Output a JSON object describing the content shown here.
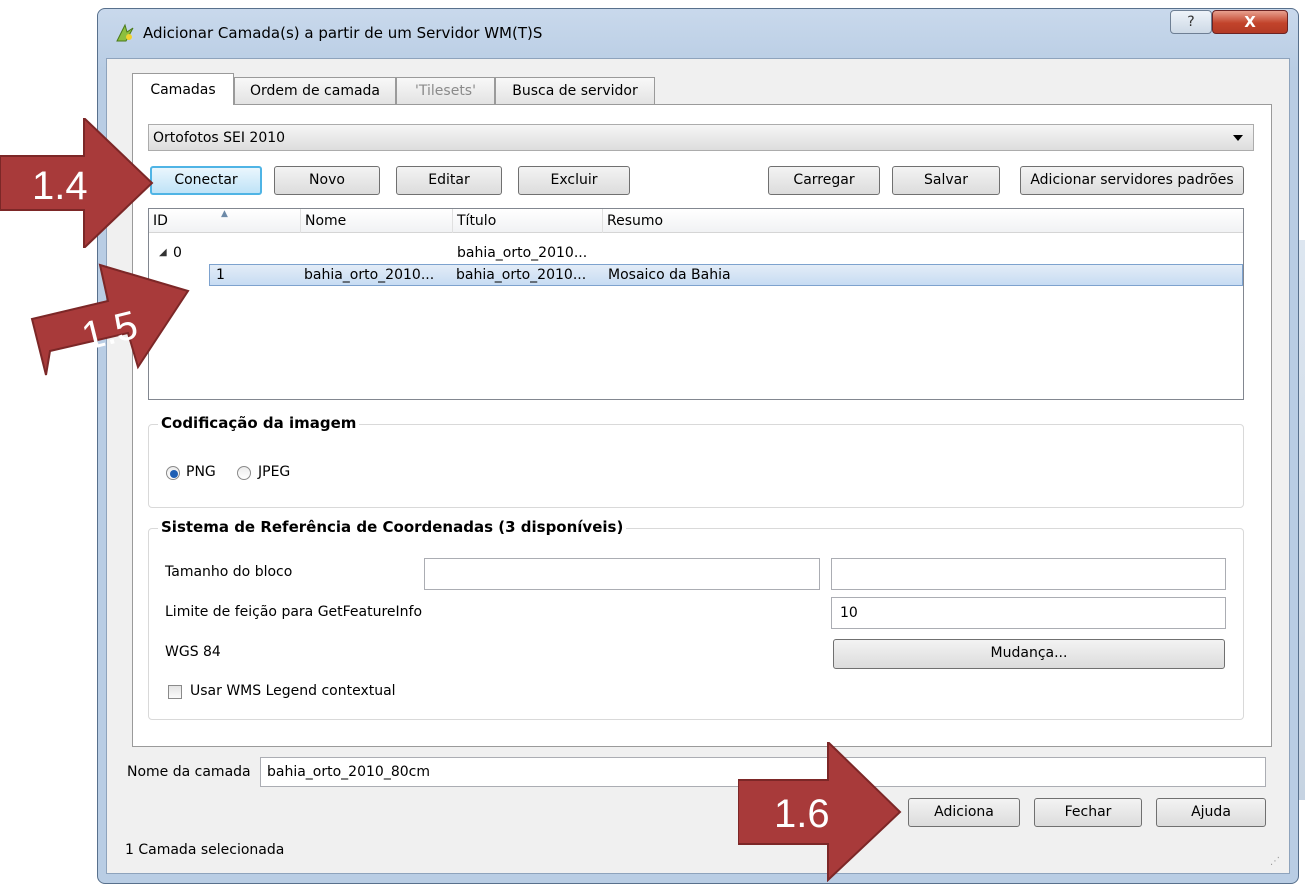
{
  "window": {
    "title": "Adicionar Camada(s) a partir de um Servidor WM(T)S",
    "help_label": "?",
    "close_label": "X"
  },
  "tabs": [
    {
      "label": "Camadas",
      "active": true
    },
    {
      "label": "Ordem de camada",
      "active": false
    },
    {
      "label": "'Tilesets'",
      "active": false,
      "disabled": true
    },
    {
      "label": "Busca de servidor",
      "active": false
    }
  ],
  "server": {
    "selected": "Ortofotos SEI 2010"
  },
  "buttons": {
    "conectar": "Conectar",
    "novo": "Novo",
    "editar": "Editar",
    "excluir": "Excluir",
    "carregar": "Carregar",
    "salvar": "Salvar",
    "adicionar_servidores": "Adicionar servidores padrões"
  },
  "layer_table": {
    "columns": [
      "ID",
      "Nome",
      "Título",
      "Resumo"
    ],
    "rows": [
      {
        "id": "0",
        "nome": "",
        "titulo": "bahia_orto_2010...",
        "resumo": "",
        "expanded": true
      },
      {
        "id": "1",
        "nome": "bahia_orto_2010...",
        "titulo": "bahia_orto_2010...",
        "resumo": "Mosaico da Bahia",
        "selected": true
      }
    ]
  },
  "encoding": {
    "title": "Codificação da imagem",
    "options": [
      "PNG",
      "JPEG"
    ],
    "selected": "PNG"
  },
  "crs": {
    "title": "Sistema de Referência de Coordenadas (3 disponíveis)",
    "tile_size_label": "Tamanho do bloco",
    "tile_size_a": "",
    "tile_size_b": "",
    "feature_limit_label": "Limite de feição para GetFeatureInfo",
    "feature_limit_value": "10",
    "crs_name": "WGS 84",
    "change_button": "Mudança...",
    "contextual_legend_label": "Usar WMS Legend contextual",
    "contextual_legend_checked": false
  },
  "layer_name": {
    "label": "Nome da camada",
    "value": "bahia_orto_2010_80cm"
  },
  "footer": {
    "adiciona": "Adiciona",
    "fechar": "Fechar",
    "ajuda": "Ajuda",
    "status": "1 Camada selecionada"
  },
  "annotations": [
    {
      "label": "1.4"
    },
    {
      "label": "1.5"
    },
    {
      "label": "1.6"
    }
  ],
  "colors": {
    "callout": "#a83a3a",
    "selection": "#c7dcf3",
    "focus_border": "#4fb4e5"
  }
}
